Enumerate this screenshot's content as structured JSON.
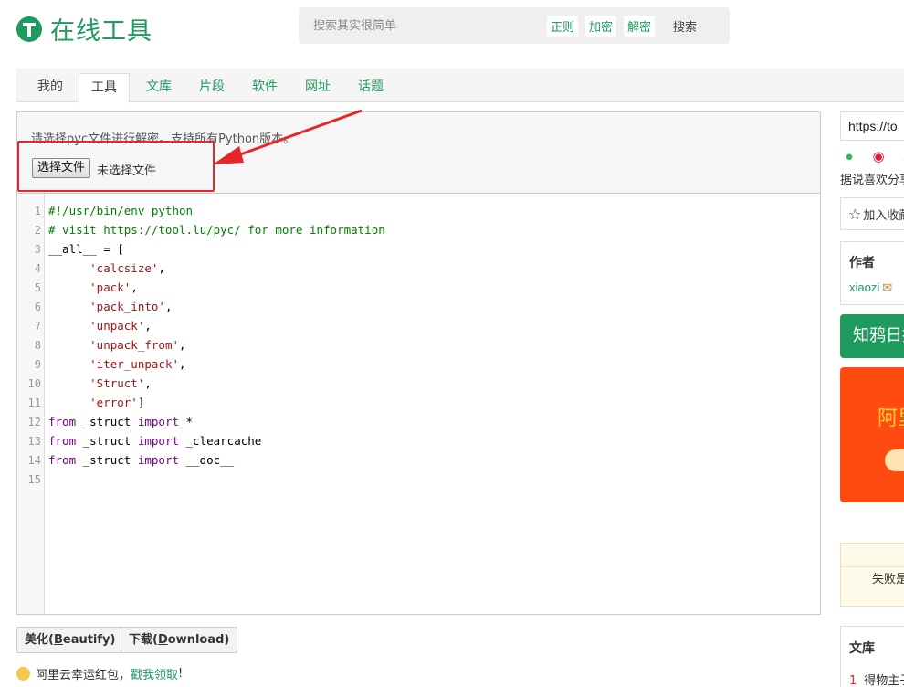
{
  "header": {
    "logo_text": "在线工具",
    "search_placeholder": "搜索其实很简单",
    "search_tags": [
      "正则",
      "加密",
      "解密"
    ],
    "search_button": "搜索"
  },
  "tabs": [
    {
      "label": "我的"
    },
    {
      "label": "工具"
    },
    {
      "label": "文库"
    },
    {
      "label": "片段"
    },
    {
      "label": "软件"
    },
    {
      "label": "网址"
    },
    {
      "label": "话题"
    }
  ],
  "active_tab": "工具",
  "upload": {
    "tip": "请选择pyc文件进行解密。支持所有Python版本。",
    "button": "选择文件",
    "status": "未选择文件"
  },
  "code_lines": [
    {
      "n": "1",
      "parts": [
        {
          "t": "#!/usr/bin/env python",
          "c": "comment"
        }
      ]
    },
    {
      "n": "2",
      "parts": [
        {
          "t": "# visit https://tool.lu/pyc/ for more information",
          "c": "comment"
        }
      ]
    },
    {
      "n": "3",
      "parts": [
        {
          "t": "__all__ = [",
          "c": "plain"
        }
      ]
    },
    {
      "n": "4",
      "parts": [
        {
          "t": "      ",
          "c": "plain"
        },
        {
          "t": "'calcsize'",
          "c": "str"
        },
        {
          "t": ",",
          "c": "plain"
        }
      ]
    },
    {
      "n": "5",
      "parts": [
        {
          "t": "      ",
          "c": "plain"
        },
        {
          "t": "'pack'",
          "c": "str"
        },
        {
          "t": ",",
          "c": "plain"
        }
      ]
    },
    {
      "n": "6",
      "parts": [
        {
          "t": "      ",
          "c": "plain"
        },
        {
          "t": "'pack_into'",
          "c": "str"
        },
        {
          "t": ",",
          "c": "plain"
        }
      ]
    },
    {
      "n": "7",
      "parts": [
        {
          "t": "      ",
          "c": "plain"
        },
        {
          "t": "'unpack'",
          "c": "str"
        },
        {
          "t": ",",
          "c": "plain"
        }
      ]
    },
    {
      "n": "8",
      "parts": [
        {
          "t": "      ",
          "c": "plain"
        },
        {
          "t": "'unpack_from'",
          "c": "str"
        },
        {
          "t": ",",
          "c": "plain"
        }
      ]
    },
    {
      "n": "9",
      "parts": [
        {
          "t": "      ",
          "c": "plain"
        },
        {
          "t": "'iter_unpack'",
          "c": "str"
        },
        {
          "t": ",",
          "c": "plain"
        }
      ]
    },
    {
      "n": "10",
      "parts": [
        {
          "t": "      ",
          "c": "plain"
        },
        {
          "t": "'Struct'",
          "c": "str"
        },
        {
          "t": ",",
          "c": "plain"
        }
      ]
    },
    {
      "n": "11",
      "parts": [
        {
          "t": "      ",
          "c": "plain"
        },
        {
          "t": "'error'",
          "c": "str"
        },
        {
          "t": "]",
          "c": "plain"
        }
      ]
    },
    {
      "n": "12",
      "parts": [
        {
          "t": "from",
          "c": "kw"
        },
        {
          "t": " _struct ",
          "c": "plain"
        },
        {
          "t": "import",
          "c": "kw"
        },
        {
          "t": " *",
          "c": "plain"
        }
      ]
    },
    {
      "n": "13",
      "parts": [
        {
          "t": "from",
          "c": "kw"
        },
        {
          "t": " _struct ",
          "c": "plain"
        },
        {
          "t": "import",
          "c": "kw"
        },
        {
          "t": " _clearcache",
          "c": "plain"
        }
      ]
    },
    {
      "n": "14",
      "parts": [
        {
          "t": "from",
          "c": "kw"
        },
        {
          "t": " _struct ",
          "c": "plain"
        },
        {
          "t": "import",
          "c": "kw"
        },
        {
          "t": " __doc__",
          "c": "plain"
        }
      ]
    },
    {
      "n": "15",
      "parts": []
    }
  ],
  "actions": {
    "beautify_prefix": "美化(",
    "beautify_key": "B",
    "beautify_rest": "eautify)",
    "download_prefix": "下载(",
    "download_key": "D",
    "download_rest": "ownload)"
  },
  "promo": {
    "text": "阿里云幸运红包，",
    "link": "戳我领取",
    "suffix": "!"
  },
  "sidebar": {
    "url": "https://to",
    "share_tip": "据说喜欢分享",
    "favorite": "加入收藏",
    "author_title": "作者",
    "author_name": "xiaozi",
    "green_banner": "知鸦日报",
    "red_title": "阿里",
    "notice": "失败是",
    "wenku_title": "文库",
    "wenku_item_num": "1",
    "wenku_item": "得物主子"
  },
  "colors": {
    "brand": "#1e9b5e",
    "highlight": "#e8262a",
    "promo_orange": "#ff4b10"
  }
}
